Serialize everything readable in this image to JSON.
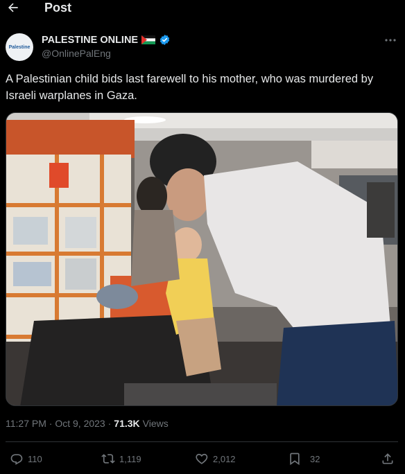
{
  "header": {
    "title": "Post"
  },
  "author": {
    "display_name": "PALESTINE ONLINE",
    "handle": "@OnlinePalEng",
    "avatar_text": "Palestine",
    "badge_color": "#1d9bf0"
  },
  "post": {
    "text": "A Palestinian child bids last farewell to his mother, who was murdered by Israeli warplanes in Gaza.",
    "time": "11:27 PM",
    "date": "Oct 9, 2023",
    "views_count": "71.3K",
    "views_label": "Views"
  },
  "actions": {
    "replies": "110",
    "reposts": "1,119",
    "likes": "2,012",
    "bookmarks": "32"
  },
  "colors": {
    "background": "#000000",
    "text": "#e7e9ea",
    "muted": "#71767b",
    "divider": "#2f3336",
    "accent": "#1d9bf0"
  }
}
